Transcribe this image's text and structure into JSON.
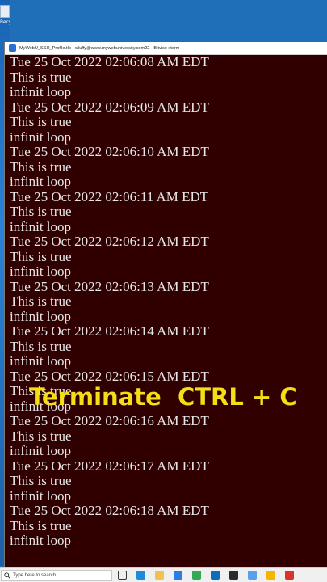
{
  "desktop": {
    "icon_label": "Recycle Bin"
  },
  "window": {
    "title": "MyWebU_SSH_Profile.tlp - wluffy@www.mywebuniversity.com22 - Bitvise xterm"
  },
  "terminal": {
    "lines": [
      "Tue 25 Oct 2022 02:06:08 AM EDT",
      "This is true",
      "infinit loop",
      "Tue 25 Oct 2022 02:06:09 AM EDT",
      "This is true",
      "infinit loop",
      "Tue 25 Oct 2022 02:06:10 AM EDT",
      "This is true",
      "infinit loop",
      "Tue 25 Oct 2022 02:06:11 AM EDT",
      "This is true",
      "infinit loop",
      "Tue 25 Oct 2022 02:06:12 AM EDT",
      "This is true",
      "infinit loop",
      "Tue 25 Oct 2022 02:06:13 AM EDT",
      "This is true",
      "infinit loop",
      "Tue 25 Oct 2022 02:06:14 AM EDT",
      "This is true",
      "infinit loop",
      "Tue 25 Oct 2022 02:06:15 AM EDT",
      "This is true",
      "infinit loop",
      "Tue 25 Oct 2022 02:06:16 AM EDT",
      "This is true",
      "infinit loop",
      "Tue 25 Oct 2022 02:06:17 AM EDT",
      "This is true",
      "infinit loop",
      "Tue 25 Oct 2022 02:06:18 AM EDT",
      "This is true",
      "infinit loop"
    ]
  },
  "overlay": {
    "caption": "Terminate  CTRL + C",
    "color": "#f4df16"
  },
  "taskbar": {
    "search_placeholder": "Type here to search",
    "icons": [
      {
        "name": "task-view-icon",
        "color": "#3a3a3a"
      },
      {
        "name": "edge-icon",
        "color": "#1e8bd6"
      },
      {
        "name": "file-explorer-icon",
        "color": "#f2c14e"
      },
      {
        "name": "store-icon",
        "color": "#2c7be5"
      },
      {
        "name": "chrome-icon",
        "color": "#34a853"
      },
      {
        "name": "mail-icon",
        "color": "#0f6cbd"
      },
      {
        "name": "terminal-app-icon",
        "color": "#2b2b2b"
      },
      {
        "name": "notepad-icon",
        "color": "#5aa0e6"
      },
      {
        "name": "notes-icon",
        "color": "#f5b400"
      },
      {
        "name": "pdf-icon",
        "color": "#d9342b"
      }
    ]
  },
  "colors": {
    "terminal_background": "#300000",
    "terminal_text": "#e6e6e6",
    "desktop": "#1f6fb8"
  }
}
